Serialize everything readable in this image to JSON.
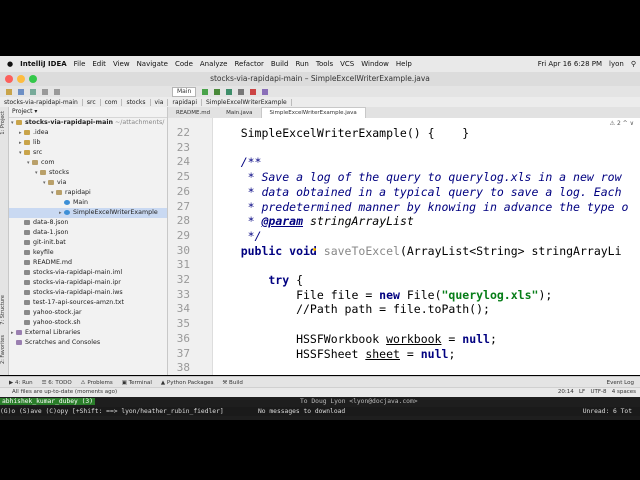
{
  "menubar": {
    "app": "IntelliJ IDEA",
    "items": [
      "File",
      "Edit",
      "View",
      "Navigate",
      "Code",
      "Analyze",
      "Refactor",
      "Build",
      "Run",
      "Tools",
      "VCS",
      "Window",
      "Help"
    ],
    "clock": "Fri Apr 16  6:28 PM",
    "user": "lyon"
  },
  "window": {
    "title": "stocks-via-rapidapi-main – SimpleExcelWriterExample.java"
  },
  "toolbar": {
    "run_config": "Main"
  },
  "breadcrumbs": [
    "stocks-via-rapidapi-main",
    "src",
    "com",
    "stocks",
    "via",
    "rapidapi",
    "SimpleExcelWriterExample"
  ],
  "sidestrip": {
    "project": "1: Project",
    "structure": "7: Structure",
    "favorites": "2: Favorites"
  },
  "project": {
    "header": "Project ▾",
    "root": "stocks-via-rapidapi-main",
    "root_path": "~/attachments/",
    "tree": [
      {
        "label": ".idea",
        "depth": 1,
        "type": "folder",
        "twisty": "▸"
      },
      {
        "label": "lib",
        "depth": 1,
        "type": "folder",
        "twisty": "▸"
      },
      {
        "label": "src",
        "depth": 1,
        "type": "folder",
        "twisty": "▾"
      },
      {
        "label": "com",
        "depth": 2,
        "type": "pkg",
        "twisty": "▾"
      },
      {
        "label": "stocks",
        "depth": 3,
        "type": "pkg",
        "twisty": "▾"
      },
      {
        "label": "via",
        "depth": 4,
        "type": "pkg",
        "twisty": "▾"
      },
      {
        "label": "rapidapi",
        "depth": 5,
        "type": "pkg",
        "twisty": "▾"
      },
      {
        "label": "Main",
        "depth": 6,
        "type": "class",
        "twisty": ""
      },
      {
        "label": "SimpleExcelWriterExample",
        "depth": 6,
        "type": "class",
        "twisty": "▸",
        "selected": true
      },
      {
        "label": "data-8.json",
        "depth": 1,
        "type": "file",
        "twisty": ""
      },
      {
        "label": "data-1.json",
        "depth": 1,
        "type": "file",
        "twisty": ""
      },
      {
        "label": "git-init.bat",
        "depth": 1,
        "type": "file",
        "twisty": ""
      },
      {
        "label": "keyfile",
        "depth": 1,
        "type": "file",
        "twisty": ""
      },
      {
        "label": "README.md",
        "depth": 1,
        "type": "file",
        "twisty": ""
      },
      {
        "label": "stocks-via-rapidapi-main.iml",
        "depth": 1,
        "type": "file",
        "twisty": ""
      },
      {
        "label": "stocks-via-rapidapi-main.ipr",
        "depth": 1,
        "type": "file",
        "twisty": ""
      },
      {
        "label": "stocks-via-rapidapi-main.iws",
        "depth": 1,
        "type": "file",
        "twisty": ""
      },
      {
        "label": "test-17-api-sources-amzn.txt",
        "depth": 1,
        "type": "file",
        "twisty": ""
      },
      {
        "label": "yahoo-stock.jar",
        "depth": 1,
        "type": "file",
        "twisty": ""
      },
      {
        "label": "yahoo-stock.sh",
        "depth": 1,
        "type": "file",
        "twisty": ""
      },
      {
        "label": "External Libraries",
        "depth": 0,
        "type": "lib",
        "twisty": "▸"
      },
      {
        "label": "Scratches and Consoles",
        "depth": 0,
        "type": "lib",
        "twisty": ""
      }
    ]
  },
  "editor_tabs": [
    {
      "label": "README.md",
      "active": false
    },
    {
      "label": "Main.java",
      "active": false
    },
    {
      "label": "SimpleExcelWriterExample.java",
      "active": true
    }
  ],
  "inspection": "⚠ 2  ^  ∨",
  "gutter": [
    "22",
    "23",
    "24",
    "25",
    "26",
    "27",
    "28",
    "29",
    "30",
    "31",
    "32",
    "33",
    "34",
    "35",
    "36",
    "37",
    "38"
  ],
  "code_tokens": [
    [
      [
        "",
        "    SimpleExcelWriterExample() {    }"
      ]
    ],
    [
      [
        "",
        ""
      ]
    ],
    [
      [
        "cm",
        "    /**"
      ]
    ],
    [
      [
        "cm",
        "     * Save a log of the query to querylog.xls in a new row"
      ]
    ],
    [
      [
        "cm",
        "     * data obtained in a typical query to save a log. Each"
      ]
    ],
    [
      [
        "cm",
        "     * predetermined manner by knowing in advance the type o"
      ]
    ],
    [
      [
        "cm",
        "     * "
      ],
      [
        "cmb und",
        "@param"
      ],
      [
        "cm",
        " "
      ],
      [
        "ital",
        "stringArrayList"
      ]
    ],
    [
      [
        "cm",
        "     */"
      ]
    ],
    [
      [
        "kw",
        "    public void "
      ],
      [
        "grey",
        "saveToExcel"
      ],
      [
        "",
        "(ArrayList<String> stringArrayLi"
      ]
    ],
    [
      [
        "",
        ""
      ]
    ],
    [
      [
        "kw",
        "        try "
      ],
      [
        "",
        "{"
      ]
    ],
    [
      [
        "",
        "            File file = "
      ],
      [
        "kw",
        "new "
      ],
      [
        "",
        "File("
      ],
      [
        "str",
        "\"querylog.xls\""
      ],
      [
        "",
        ");"
      ]
    ],
    [
      [
        "",
        "            //Path path = file.toPath();"
      ]
    ],
    [
      [
        "",
        ""
      ]
    ],
    [
      [
        "",
        "            HSSFWorkbook "
      ],
      [
        "und",
        "workbook"
      ],
      [
        "",
        " = "
      ],
      [
        "kw",
        "null"
      ],
      [
        "",
        ";"
      ]
    ],
    [
      [
        "",
        "            HSSFSheet "
      ],
      [
        "und",
        "sheet"
      ],
      [
        "",
        " = "
      ],
      [
        "kw",
        "null"
      ],
      [
        "",
        ";"
      ]
    ],
    [
      [
        "",
        ""
      ]
    ]
  ],
  "bottom_bar": {
    "items": [
      "▶ 4: Run",
      "☰ 6: TODO",
      "⚠ Problems",
      "▣ Terminal",
      "▲ Python Packages",
      "⚒ Build"
    ],
    "event_log": "Event Log"
  },
  "status": {
    "message": "All files are up-to-date (moments ago)",
    "caret": "20:14",
    "line_sep": "LF",
    "encoding": "UTF-8",
    "indent": "4 spaces"
  },
  "terminal": {
    "line1_highlight": "abhishek_kumar_dubey (3)",
    "line1_mid": "To Doug Lyon <lyon@docjava.com>",
    "line2_left": "(G)o (S)ave (C)opy [+Shift: ==> lyon/heather_rubin_fiedler]",
    "line2_mid": "No messages to download",
    "line2_right": "Unread: 6  Tot"
  }
}
